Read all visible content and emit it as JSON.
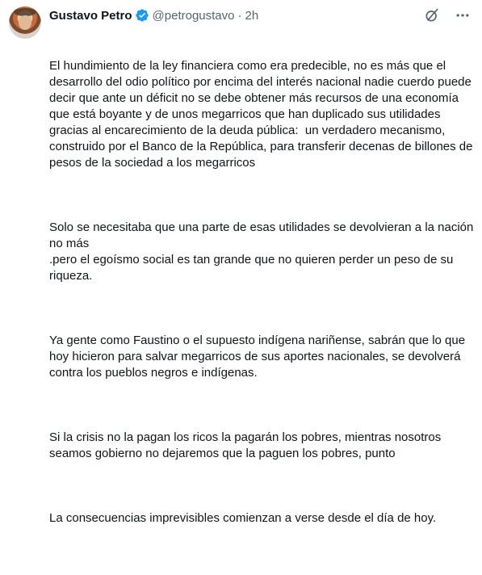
{
  "author": {
    "name": "Gustavo Petro",
    "handle": "@petrogustavo",
    "separator": "·",
    "time": "2h"
  },
  "icons": {
    "verified": "verified-badge-icon",
    "grok": "grok-icon",
    "more": "more-options-icon"
  },
  "colors": {
    "verified": "#1d9bf0",
    "text": "#0f1419",
    "secondary": "#536471"
  },
  "tweet": {
    "paragraphs": [
      "El hundimiento de la ley financiera como era predecible, no es más que el desarrollo del odio político por encima del interés nacional nadie cuerdo puede decir que ante un déficit no se debe obtener más recursos de una economía que está boyante y de unos megarricos que han duplicado sus utilidades gracias al encarecimiento de la deuda pública:  un verdadero mecanismo, construido por el Banco de la República, para transferir decenas de billones de pesos de la sociedad a los megarricos",
      "Solo se necesitaba que una parte de esas utilidades se devolvieran a la nación no más\n.pero el egoísmo social es tan grande que no quieren perder un peso de su riqueza.",
      "Ya gente como Faustino o el supuesto indígena nariñense, sabrán que lo que hoy hicieron para salvar megarricos de sus aportes nacionales, se devolverá contra los pueblos negros e indígenas.",
      "Si la crisis no la pagan los ricos la pagarán los pobres, mientras nosotros seamos gobierno no dejaremos que la paguen los pobres, punto",
      "La consecuencias imprevisibles comienzan a verse desde el día de hoy."
    ]
  }
}
